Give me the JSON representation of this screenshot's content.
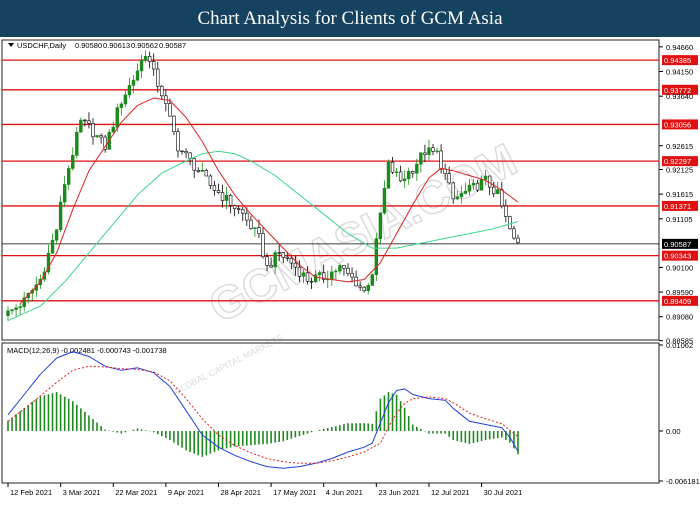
{
  "banner": {
    "title": "Chart Analysis for Clients of GCM Asia"
  },
  "watermark": {
    "text": "GCMASIA.COM",
    "sub": "GLOBAL CAPITAL MARKETS"
  },
  "colors": {
    "bull_candle": "#1a8a1a",
    "bear_candle": "#000000",
    "sma_fast": "#e02020",
    "sma_slow": "#3cd68c",
    "level_line": "#e01010",
    "current_line": "#000000",
    "macd_line": "#1f3fe0",
    "signal_line": "#e02020",
    "hist": "#1e8a1e"
  },
  "chart_data": [
    {
      "type": "candlestick",
      "symbol_info": {
        "label": "USDCHF,Daily",
        "open": "0.90580",
        "high": "0.90613",
        "low": "0.90562",
        "close": "0.90587"
      },
      "ylim": [
        0.8862,
        0.9476
      ],
      "y_ticks": [
        {
          "label": "0.94660",
          "value": 0.9466
        },
        {
          "label": "0.94150",
          "value": 0.9415
        },
        {
          "label": "0.93640",
          "value": 0.9364
        },
        {
          "label": "0.92615",
          "value": 0.92615
        },
        {
          "label": "0.92125",
          "value": 0.92125
        },
        {
          "label": "0.91615",
          "value": 0.91615
        },
        {
          "label": "0.91105",
          "value": 0.91105
        },
        {
          "label": "0.90100",
          "value": 0.901
        },
        {
          "label": "0.89590",
          "value": 0.8959
        },
        {
          "label": "0.89080",
          "value": 0.8908
        },
        {
          "label": "0.88585",
          "value": 0.88585
        }
      ],
      "levels": [
        {
          "label": "0.94385",
          "value": 0.94385
        },
        {
          "label": "0.93772",
          "value": 0.93772
        },
        {
          "label": "0.93056",
          "value": 0.93056
        },
        {
          "label": "0.92297",
          "value": 0.92297
        },
        {
          "label": "0.91371",
          "value": 0.91371
        },
        {
          "label": "0.90343",
          "value": 0.90343
        },
        {
          "label": "0.89409",
          "value": 0.89409
        }
      ],
      "current": {
        "label": "0.90587",
        "value": 0.90587
      },
      "close_path": [
        [
          0,
          0.8915
        ],
        [
          4,
          0.894
        ],
        [
          8,
          0.8985
        ],
        [
          12,
          0.909
        ],
        [
          14,
          0.9185
        ],
        [
          18,
          0.931
        ],
        [
          20,
          0.93
        ],
        [
          24,
          0.926
        ],
        [
          28,
          0.9355
        ],
        [
          31,
          0.94
        ],
        [
          34,
          0.9455
        ],
        [
          36,
          0.941
        ],
        [
          38,
          0.937
        ],
        [
          42,
          0.926
        ],
        [
          46,
          0.922
        ],
        [
          50,
          0.918
        ],
        [
          54,
          0.915
        ],
        [
          58,
          0.912
        ],
        [
          62,
          0.907
        ],
        [
          64,
          0.901
        ],
        [
          67,
          0.904
        ],
        [
          70,
          0.902
        ],
        [
          74,
          0.8985
        ],
        [
          78,
          0.899
        ],
        [
          82,
          0.901
        ],
        [
          86,
          0.898
        ],
        [
          88,
          0.896
        ],
        [
          90,
          0.9
        ],
        [
          92,
          0.912
        ],
        [
          94,
          0.922
        ],
        [
          97,
          0.919
        ],
        [
          100,
          0.9215
        ],
        [
          103,
          0.925
        ],
        [
          106,
          0.9245
        ],
        [
          108,
          0.92
        ],
        [
          110,
          0.915
        ],
        [
          114,
          0.917
        ],
        [
          118,
          0.919
        ],
        [
          121,
          0.916
        ],
        [
          123,
          0.911
        ],
        [
          125,
          0.9065
        ],
        [
          126,
          0.9059
        ]
      ],
      "sma_fast": [
        [
          3,
          0.8935
        ],
        [
          8,
          0.898
        ],
        [
          12,
          0.904
        ],
        [
          16,
          0.913
        ],
        [
          20,
          0.921
        ],
        [
          24,
          0.926
        ],
        [
          28,
          0.931
        ],
        [
          32,
          0.9345
        ],
        [
          36,
          0.936
        ],
        [
          40,
          0.9355
        ],
        [
          44,
          0.932
        ],
        [
          48,
          0.927
        ],
        [
          52,
          0.921
        ],
        [
          56,
          0.916
        ],
        [
          60,
          0.912
        ],
        [
          64,
          0.9085
        ],
        [
          68,
          0.905
        ],
        [
          72,
          0.9015
        ],
        [
          76,
          0.899
        ],
        [
          80,
          0.8985
        ],
        [
          84,
          0.898
        ],
        [
          88,
          0.8985
        ],
        [
          92,
          0.902
        ],
        [
          96,
          0.908
        ],
        [
          100,
          0.914
        ],
        [
          104,
          0.9195
        ],
        [
          107,
          0.9215
        ],
        [
          110,
          0.921
        ],
        [
          114,
          0.92
        ],
        [
          118,
          0.919
        ],
        [
          122,
          0.917
        ],
        [
          126,
          0.9145
        ]
      ],
      "sma_slow": [
        [
          0,
          0.89
        ],
        [
          8,
          0.893
        ],
        [
          14,
          0.898
        ],
        [
          20,
          0.904
        ],
        [
          26,
          0.91
        ],
        [
          32,
          0.916
        ],
        [
          38,
          0.9205
        ],
        [
          44,
          0.923
        ],
        [
          48,
          0.9245
        ],
        [
          52,
          0.925
        ],
        [
          56,
          0.9245
        ],
        [
          60,
          0.923
        ],
        [
          66,
          0.92
        ],
        [
          72,
          0.916
        ],
        [
          78,
          0.912
        ],
        [
          84,
          0.908
        ],
        [
          90,
          0.905
        ],
        [
          96,
          0.905
        ],
        [
          102,
          0.906
        ],
        [
          108,
          0.907
        ],
        [
          114,
          0.908
        ],
        [
          120,
          0.909
        ],
        [
          126,
          0.9105
        ]
      ]
    },
    {
      "type": "macd",
      "label": "MACD(12,26,9) -0.002481 -0.000743 -0.001738",
      "ylim": [
        -0.006181,
        0.01062
      ],
      "y_ticks": [
        {
          "label": "0.01062",
          "value": 0.01062
        },
        {
          "label": "0.00",
          "value": 0.0
        },
        {
          "label": "-0.006181",
          "value": -0.006181
        }
      ],
      "macd": [
        [
          0,
          0.002
        ],
        [
          4,
          0.0045
        ],
        [
          8,
          0.007
        ],
        [
          12,
          0.009
        ],
        [
          16,
          0.0098
        ],
        [
          20,
          0.0092
        ],
        [
          24,
          0.008
        ],
        [
          28,
          0.0075
        ],
        [
          32,
          0.0078
        ],
        [
          36,
          0.0072
        ],
        [
          40,
          0.0055
        ],
        [
          44,
          0.0025
        ],
        [
          48,
          -0.0005
        ],
        [
          52,
          -0.002
        ],
        [
          56,
          -0.003
        ],
        [
          60,
          -0.0038
        ],
        [
          64,
          -0.0044
        ],
        [
          68,
          -0.0046
        ],
        [
          72,
          -0.0044
        ],
        [
          76,
          -0.004
        ],
        [
          80,
          -0.0034
        ],
        [
          84,
          -0.0026
        ],
        [
          88,
          -0.002
        ],
        [
          90,
          -0.0015
        ],
        [
          92,
          0.001
        ],
        [
          94,
          0.0035
        ],
        [
          96,
          0.005
        ],
        [
          98,
          0.0052
        ],
        [
          100,
          0.0045
        ],
        [
          104,
          0.004
        ],
        [
          108,
          0.0038
        ],
        [
          110,
          0.0028
        ],
        [
          114,
          0.0012
        ],
        [
          118,
          0.0008
        ],
        [
          122,
          0.0004
        ],
        [
          124,
          -0.0008
        ],
        [
          126,
          -0.0025
        ]
      ],
      "signal": [
        [
          0,
          0.0012
        ],
        [
          6,
          0.0035
        ],
        [
          12,
          0.006
        ],
        [
          16,
          0.0075
        ],
        [
          20,
          0.008
        ],
        [
          24,
          0.0079
        ],
        [
          28,
          0.0077
        ],
        [
          32,
          0.0076
        ],
        [
          36,
          0.0073
        ],
        [
          40,
          0.0062
        ],
        [
          44,
          0.004
        ],
        [
          48,
          0.0015
        ],
        [
          52,
          -0.0005
        ],
        [
          56,
          -0.0018
        ],
        [
          60,
          -0.0027
        ],
        [
          64,
          -0.0034
        ],
        [
          68,
          -0.0038
        ],
        [
          72,
          -0.004
        ],
        [
          76,
          -0.004
        ],
        [
          80,
          -0.0037
        ],
        [
          84,
          -0.0032
        ],
        [
          88,
          -0.0026
        ],
        [
          92,
          -0.0015
        ],
        [
          94,
          0.0005
        ],
        [
          96,
          0.0022
        ],
        [
          98,
          0.0034
        ],
        [
          100,
          0.004
        ],
        [
          104,
          0.0042
        ],
        [
          108,
          0.004
        ],
        [
          110,
          0.0035
        ],
        [
          114,
          0.0022
        ],
        [
          118,
          0.0015
        ],
        [
          122,
          0.0009
        ],
        [
          126,
          -0.0007
        ]
      ]
    }
  ],
  "x_axis": {
    "labels": [
      {
        "label": "12 Feb 2021",
        "index": 0
      },
      {
        "label": "3 Mar 2021",
        "index": 13
      },
      {
        "label": "22 Mar 2021",
        "index": 26
      },
      {
        "label": "9 Apr 2021",
        "index": 39
      },
      {
        "label": "28 Apr 2021",
        "index": 52
      },
      {
        "label": "17 May 2021",
        "index": 65
      },
      {
        "label": "4 Jun 2021",
        "index": 78
      },
      {
        "label": "23 Jun 2021",
        "index": 91
      },
      {
        "label": "12 Jul 2021",
        "index": 104
      },
      {
        "label": "30 Jul 2021",
        "index": 117
      }
    ]
  }
}
